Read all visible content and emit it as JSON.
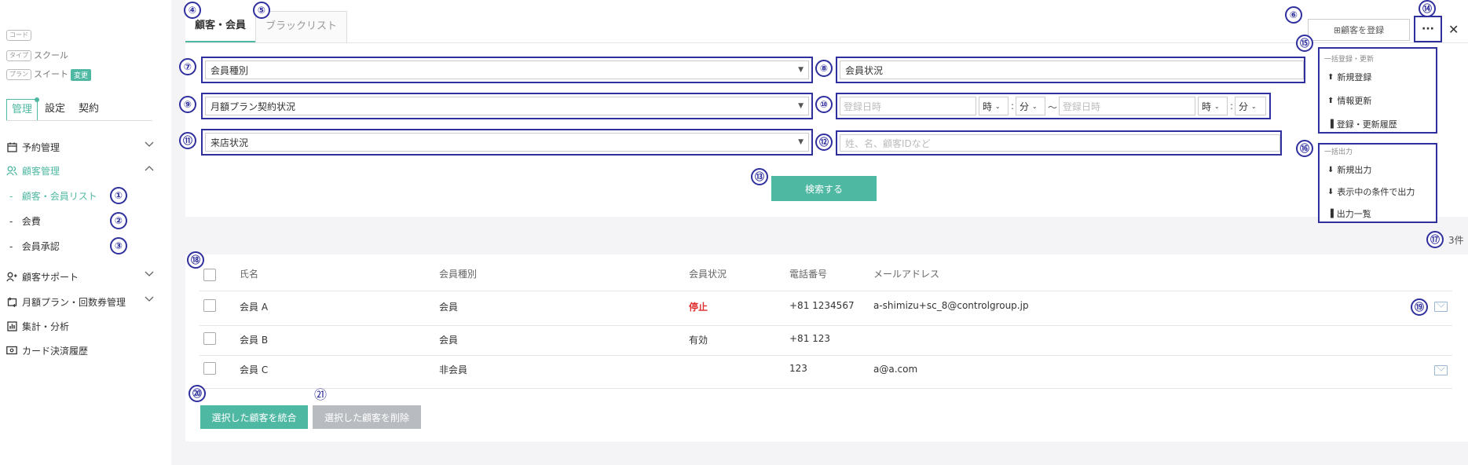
{
  "sidebar": {
    "code_tag": "コード",
    "type_tag": "タイプ",
    "type_value": "スクール",
    "plan_tag": "プラン",
    "plan_value": "スイート",
    "change_badge": "変更",
    "tabs": [
      "管理",
      "設定",
      "契約"
    ],
    "nav": [
      {
        "label": "予約管理"
      },
      {
        "label": "顧客管理"
      },
      {
        "label": "顧客サポート"
      },
      {
        "label": "月額プラン・回数券管理"
      },
      {
        "label": "集計・分析"
      },
      {
        "label": "カード決済履歴"
      }
    ],
    "sub": [
      "顧客・会員リスト",
      "会費",
      "会員承認"
    ],
    "sub_prefix": "-"
  },
  "markers": [
    "①",
    "②",
    "③",
    "④",
    "⑤",
    "⑥",
    "⑦",
    "⑧",
    "⑨",
    "⑩",
    "⑪",
    "⑫",
    "⑬",
    "⑭",
    "⑮",
    "⑯",
    "⑰",
    "⑱",
    "⑲",
    "⑳",
    "㉑"
  ],
  "main": {
    "tabs": [
      "顧客・会員",
      "ブラックリスト"
    ],
    "register_button": "⊞顧客を登録",
    "more_button": "···",
    "close_button": "✕",
    "filters": {
      "member_type": "会員種別",
      "member_status": "会員状況",
      "monthly_plan": "月額プラン契約状況",
      "date_placeholder": "登録日時",
      "hour": "時",
      "minute": "分",
      "colon": ":",
      "tilde": "〜",
      "visit_status": "来店状況",
      "search_placeholder": "姓、名、顧客IDなど"
    },
    "search_button": "検索する",
    "bulk_menu": {
      "header1": "一括登録・更新",
      "items1": [
        "新規登録",
        "情報更新",
        "登録・更新履歴"
      ],
      "header2": "一括出力",
      "items2": [
        "新規出力",
        "表示中の条件で出力",
        "出力一覧"
      ]
    },
    "count": "3件"
  },
  "table": {
    "headers": [
      "氏名",
      "会員種別",
      "会員状況",
      "電話番号",
      "メールアドレス"
    ],
    "rows": [
      {
        "name": "会員 A",
        "type": "会員",
        "status": "停止",
        "phone": "+81 1234567",
        "email": "a-shimizu+sc_8@controlgroup.jp"
      },
      {
        "name": "会員 B",
        "type": "会員",
        "status": "有効",
        "phone": "+81 123",
        "email": ""
      },
      {
        "name": "会員 C",
        "type": "非会員",
        "status": "",
        "phone": "123",
        "email": "a@a.com"
      }
    ],
    "merge_button": "選択した顧客を統合",
    "delete_button": "選択した顧客を削除"
  },
  "colors": {
    "accent": "#4fb8a3",
    "marker": "#2f2f9e",
    "danger": "#e03030"
  }
}
